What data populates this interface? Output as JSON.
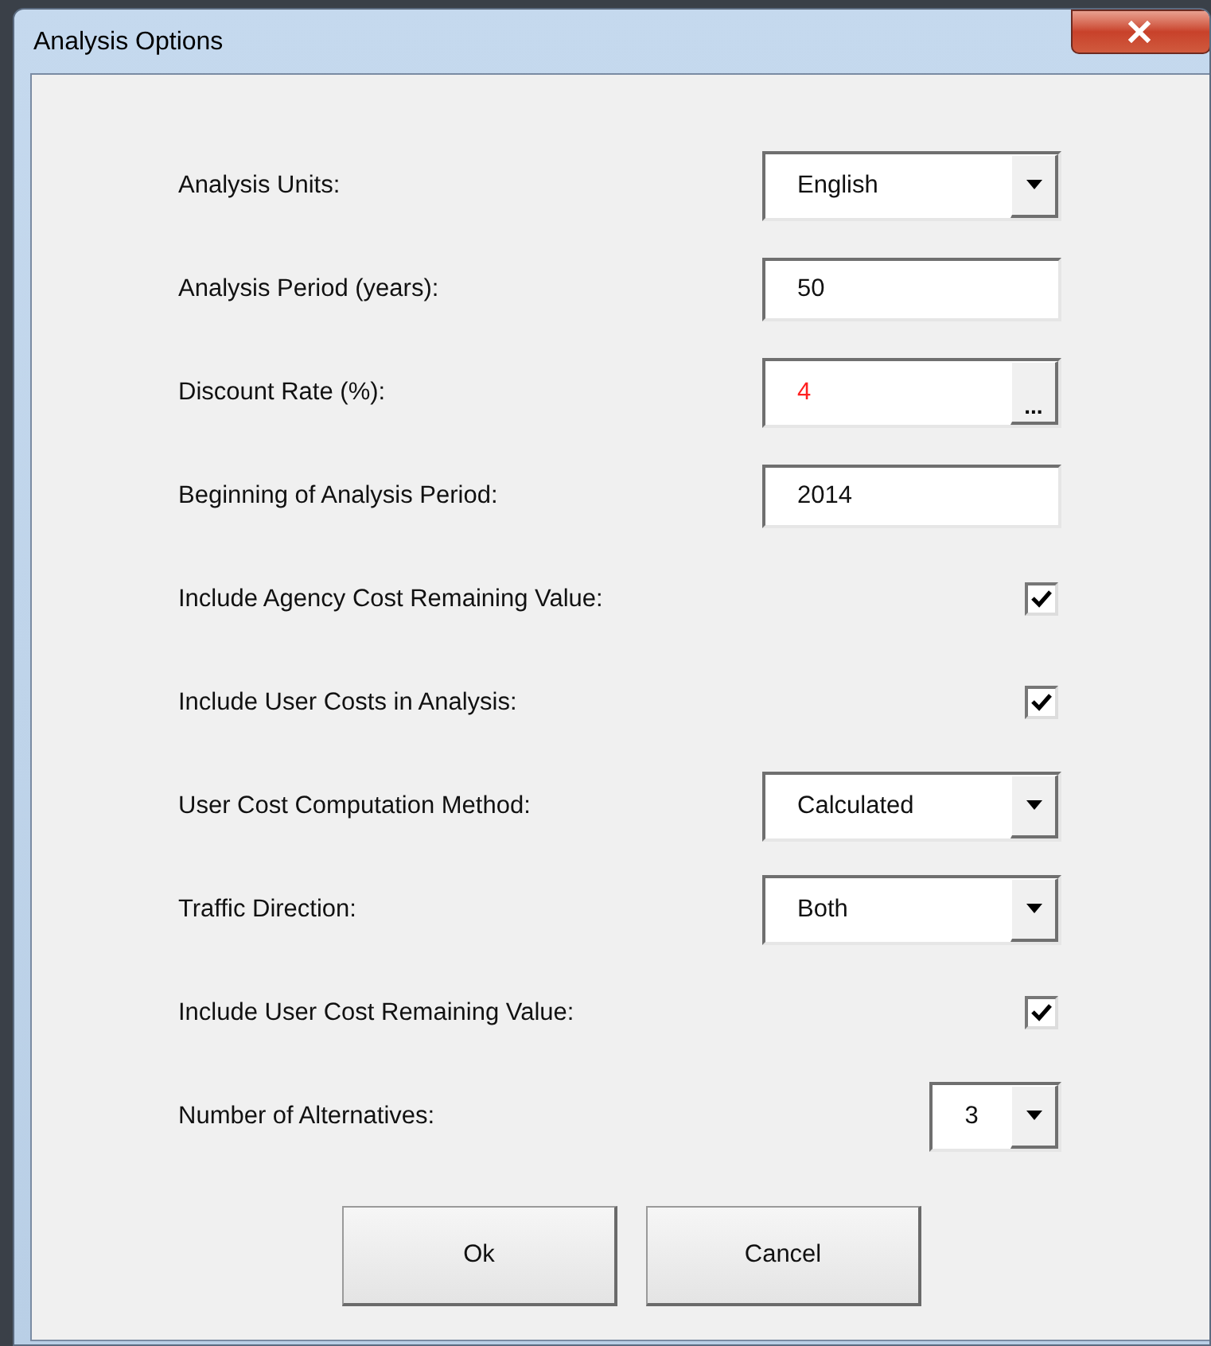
{
  "window": {
    "title": "Analysis Options"
  },
  "fields": [
    {
      "kind": "dropdown",
      "label": "Analysis Units:",
      "value": "English"
    },
    {
      "kind": "text",
      "label": "Analysis Period (years):",
      "value": "50"
    },
    {
      "kind": "ellipsis",
      "label": "Discount Rate (%):",
      "value": "4",
      "color": "#ff2020",
      "button": "..."
    },
    {
      "kind": "text",
      "label": "Beginning of Analysis Period:",
      "value": "2014"
    },
    {
      "kind": "checkbox",
      "label": "Include Agency Cost Remaining Value:",
      "checked": true
    },
    {
      "kind": "checkbox",
      "label": "Include User Costs in Analysis:",
      "checked": true
    },
    {
      "kind": "dropdown",
      "label": "User Cost Computation Method:",
      "value": "Calculated"
    },
    {
      "kind": "dropdown",
      "label": "Traffic Direction:",
      "value": "Both"
    },
    {
      "kind": "checkbox",
      "label": "Include User Cost Remaining Value:",
      "checked": true
    },
    {
      "kind": "short_dropdown",
      "label": "Number of Alternatives:",
      "value": "3"
    }
  ],
  "buttons": [
    "Ok",
    "Cancel"
  ]
}
